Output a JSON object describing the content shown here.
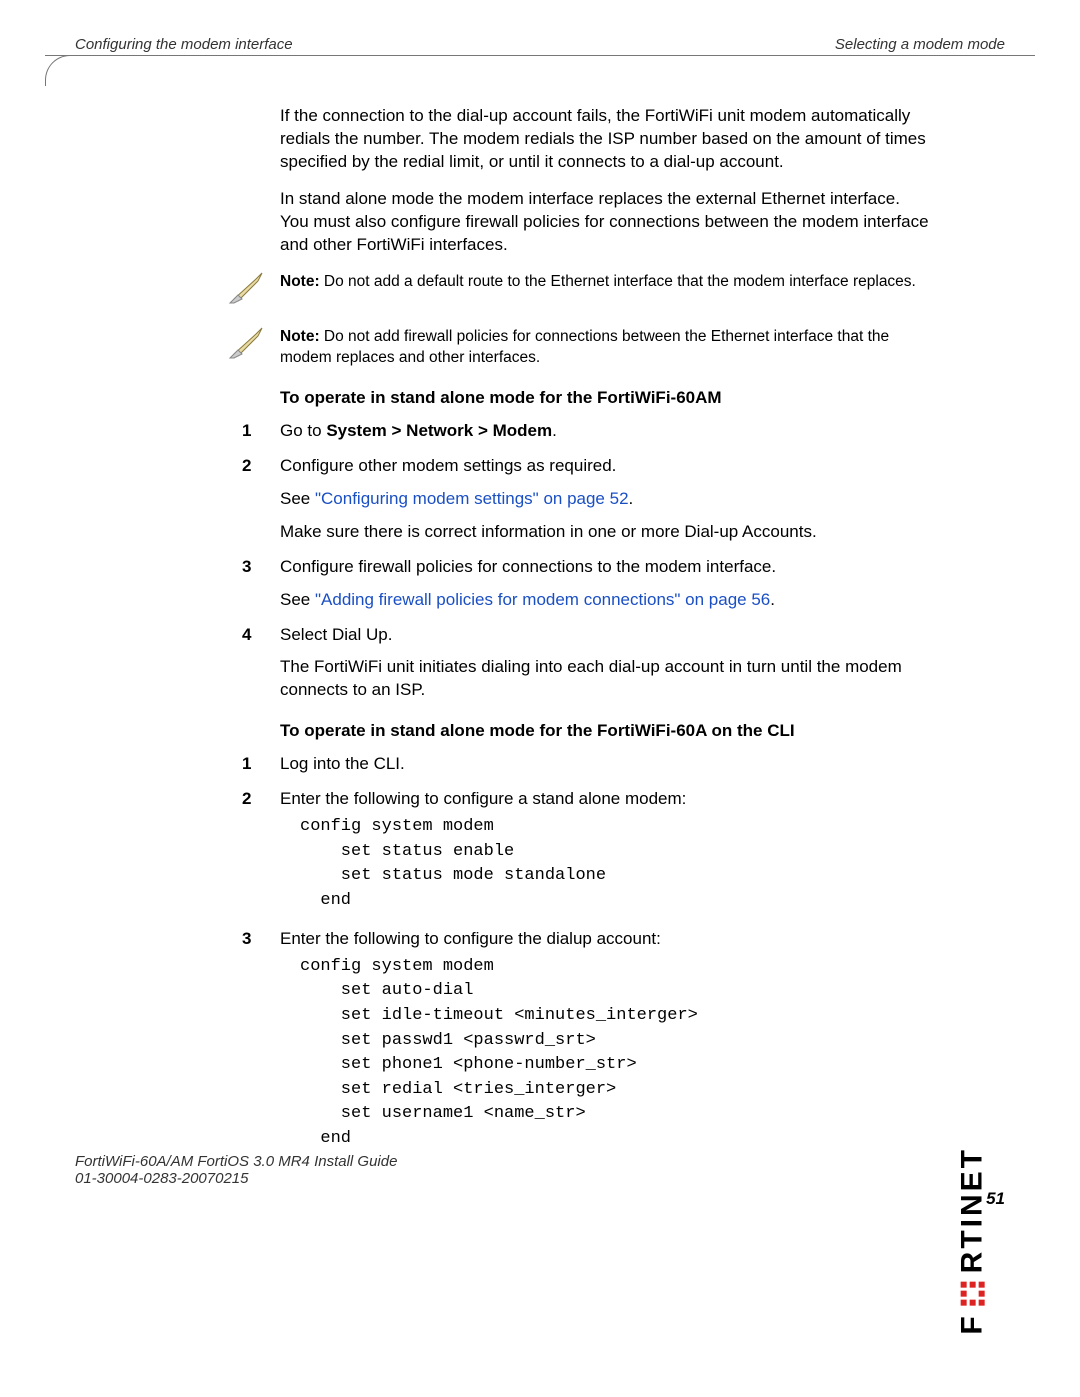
{
  "header": {
    "left": "Configuring the modem interface",
    "right": "Selecting a modem mode"
  },
  "intro": {
    "p1": "If the connection to the dial-up account fails, the FortiWiFi unit modem automatically redials the number. The modem redials the ISP number based on the amount of times specified by the redial limit, or until it connects to a dial-up account.",
    "p2": "In stand alone mode the modem interface replaces the external Ethernet interface. You must also configure firewall policies for connections between the modem interface and other FortiWiFi interfaces."
  },
  "notes": {
    "label": "Note:",
    "n1": " Do not add a default route to the Ethernet interface that the modem interface replaces.",
    "n2": " Do not add firewall policies for connections between the Ethernet interface that the modem replaces and other interfaces."
  },
  "section1": {
    "title": "To operate in stand alone mode for the FortiWiFi-60AM",
    "steps": {
      "s1pre": "Go to ",
      "s1path": "System > Network > Modem",
      "s1post": ".",
      "s2": "Configure other modem settings as required.",
      "s2see_pre": "See ",
      "s2see_link": "\"Configuring modem settings\" on page 52",
      "s2see_post": ".",
      "s2extra": "Make sure there is correct information in one or more Dial-up Accounts.",
      "s3": "Configure firewall policies for connections to the modem interface.",
      "s3see_pre": "See ",
      "s3see_link": "\"Adding firewall policies for modem connections\" on page 56",
      "s3see_post": ".",
      "s4": "Select Dial Up.",
      "s4extra": "The FortiWiFi unit initiates dialing into each dial-up account in turn until the modem connects to an ISP."
    }
  },
  "section2": {
    "title": "To operate in stand alone mode for the FortiWiFi-60A on the CLI",
    "steps": {
      "s1": "Log into the CLI.",
      "s2": "Enter the following to configure a stand alone modem:",
      "code1": "config system modem\n    set status enable\n    set status mode standalone\n  end",
      "s3": "Enter the following to configure the dialup account:",
      "code2": "config system modem\n    set auto-dial\n    set idle-timeout <minutes_interger>\n    set passwd1 <passwrd_srt>\n    set phone1 <phone-number_str>\n    set redial <tries_interger>\n    set username1 <name_str>\n  end"
    }
  },
  "brand": "RTINET",
  "footer": {
    "line1": "FortiWiFi-60A/AM FortiOS 3.0 MR4 Install Guide",
    "line2": "01-30004-0283-20070215",
    "page": "51"
  }
}
